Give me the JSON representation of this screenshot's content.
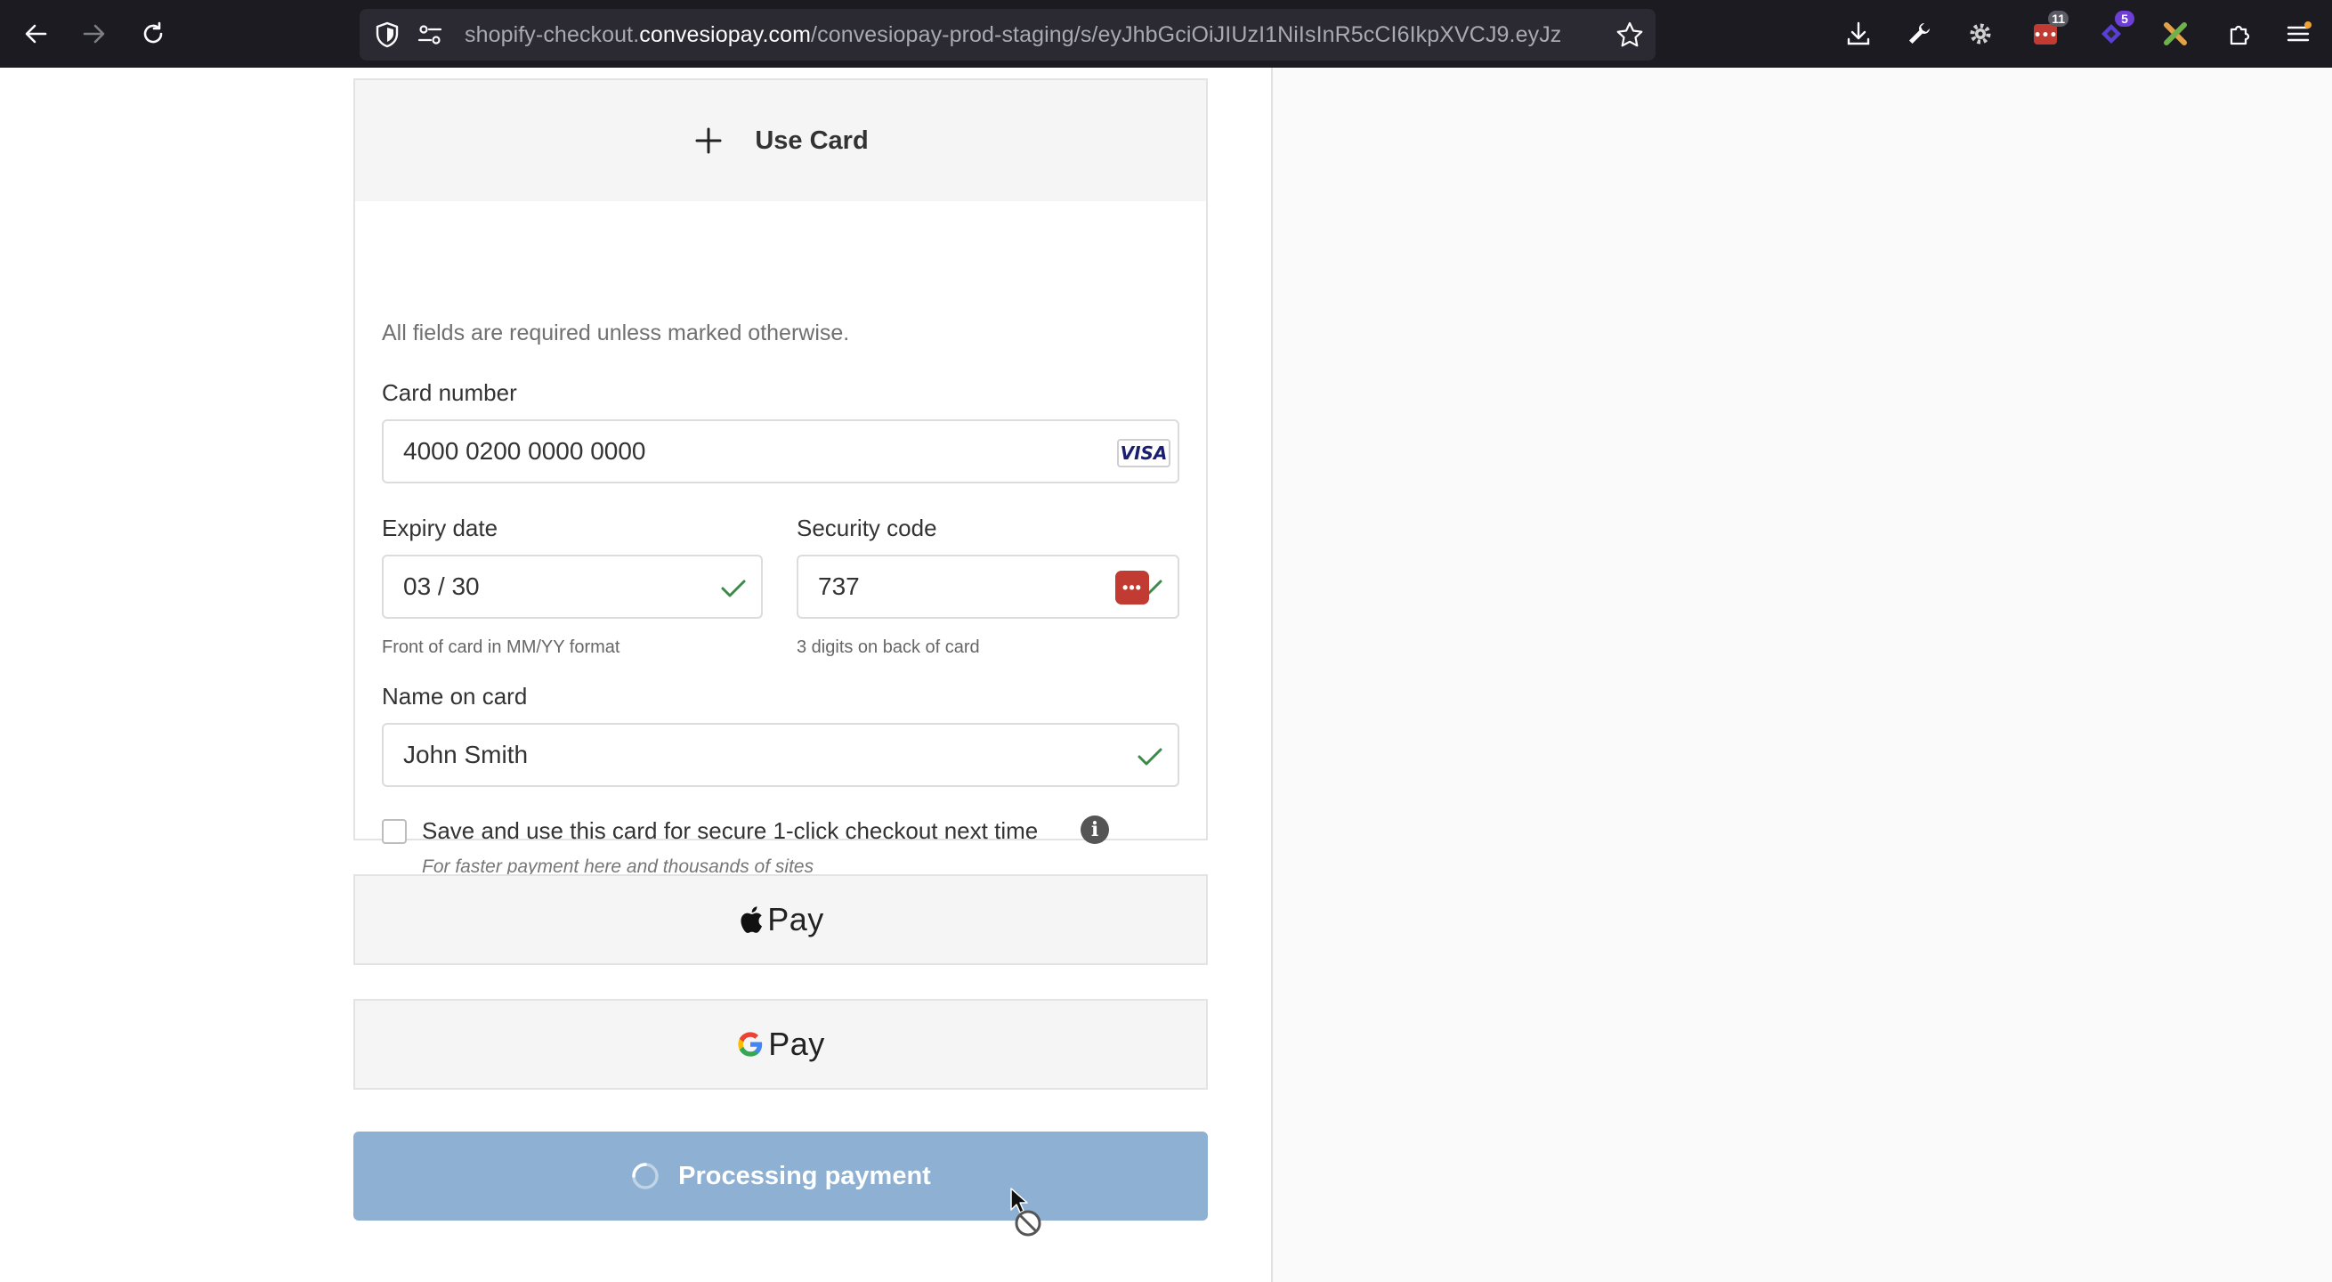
{
  "browser": {
    "url_prefix": "shopify-checkout.",
    "url_domain": "convesiopay.com",
    "url_path": "/convesiopay-prod-staging/s/eyJhbGciOiJIUzI1NiIsInR5cCI6IkpXVCJ9.eyJz",
    "extension_badges": {
      "red_ext": "11",
      "purple_ext": "5"
    },
    "icons": [
      "back-icon",
      "forward-icon",
      "reload-icon",
      "shield-icon",
      "permissions-icon",
      "bookmark-star-icon",
      "downloads-icon",
      "wrench-icon",
      "gear-icon",
      "extensions-icon",
      "menu-icon"
    ]
  },
  "card_form": {
    "header_label": "Use Card",
    "required_note": "All fields are required unless marked otherwise.",
    "card_number": {
      "label": "Card number",
      "value": "4000 0200 0000 0000",
      "brand": "VISA"
    },
    "expiry": {
      "label": "Expiry date",
      "value": "03 / 30",
      "hint": "Front of card in MM/YY format"
    },
    "security": {
      "label": "Security code",
      "value": "737",
      "hint": "3 digits on back of card"
    },
    "name": {
      "label": "Name on card",
      "value": "John Smith"
    },
    "save": {
      "label": "Save and use this card for secure 1-click checkout next time",
      "sublabel": "For faster payment here and thousands of sites",
      "checked": false
    }
  },
  "wallets": {
    "apple_pay_label": "Pay",
    "google_pay_label": "Pay"
  },
  "submit": {
    "label": "Processing payment",
    "state": "processing"
  },
  "colors": {
    "submit_bg": "#8db0d3",
    "valid_check": "#3c8a4a",
    "toolbar_bg": "#1c1b22"
  }
}
